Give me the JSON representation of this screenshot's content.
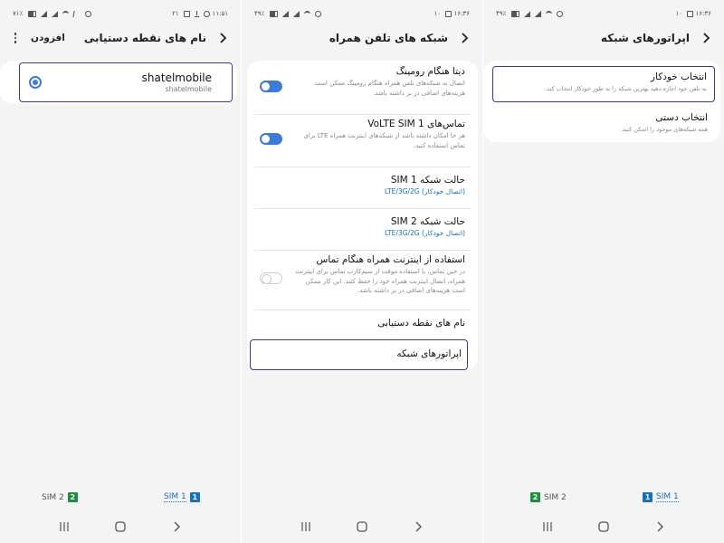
{
  "colors": {
    "accent": "#3e7bd6",
    "highlight_border": "#3c3a8c",
    "sim1": "#1a6fb6",
    "sim2": "#1e8e3e"
  },
  "screen1": {
    "status": {
      "time": "۱۱:۵۱",
      "left_text": "۲۱",
      "battery": "۷۱٪"
    },
    "title": "نام های نقطه دستیابی",
    "add_label": "افزودن",
    "apn": {
      "name": "shatelmobile",
      "sub": "shatelmobile"
    },
    "sim_tabs": {
      "sim1": "SIM 1",
      "sim1_num": "1",
      "sim2": "SIM 2",
      "sim2_num": "2"
    }
  },
  "screen2": {
    "status": {
      "time": "۱۶:۳۶",
      "left_text": "۱۰",
      "battery": "۴۹٪"
    },
    "title": "شبکه های تلفن همراه",
    "rows": [
      {
        "title": "دیتا هنگام رومینگ",
        "desc": "اتصال به شبکه‌های تلفن همراه هنگام رومینگ ممکن است هزینه‌های اضافی در بر داشته باشد."
      },
      {
        "title": "تماس‌های VoLTE SIM 1",
        "desc": "هر جا امکان داشته باشد از شبکه‌های اینترنت همراه LTE برای تماس استفاده کنید."
      },
      {
        "title": "حالت شبکه SIM 1",
        "value": "LTE/3G/2G (اتصال خودکار)"
      },
      {
        "title": "حالت شبکه SIM 2",
        "value": "LTE/3G/2G (اتصال خودکار)"
      },
      {
        "title": "استفاده از اینترنت همراه هنگام تماس",
        "desc": "در حین تماس، با استفاده موقت از سیم‌کارت تماس برای اینترنت همراه، اتصال اینترنت همراه خود را حفظ کنید. این کار ممکن است هزینه‌های اضافی در بر داشته باشد."
      },
      {
        "title": "نام های نقطه دستیابی"
      },
      {
        "title": "اپراتورهای شبکه"
      }
    ]
  },
  "screen3": {
    "status": {
      "time": "۱۶:۳۶",
      "left_text": "۱۰",
      "battery": "۴۹٪"
    },
    "title": "اپراتورهای شبکه",
    "rows": [
      {
        "title": "انتخاب خودکار",
        "desc": "به تلفن خود اجازه دهید بهترین شبکه را به طور خودکار انتخاب کند."
      },
      {
        "title": "انتخاب دستی",
        "desc": "همه شبکه‌های موجود را اسکن کنید."
      }
    ],
    "sim_tabs": {
      "sim1": "SIM 1",
      "sim1_num": "1",
      "sim2": "SIM 2",
      "sim2_num": "2"
    }
  }
}
